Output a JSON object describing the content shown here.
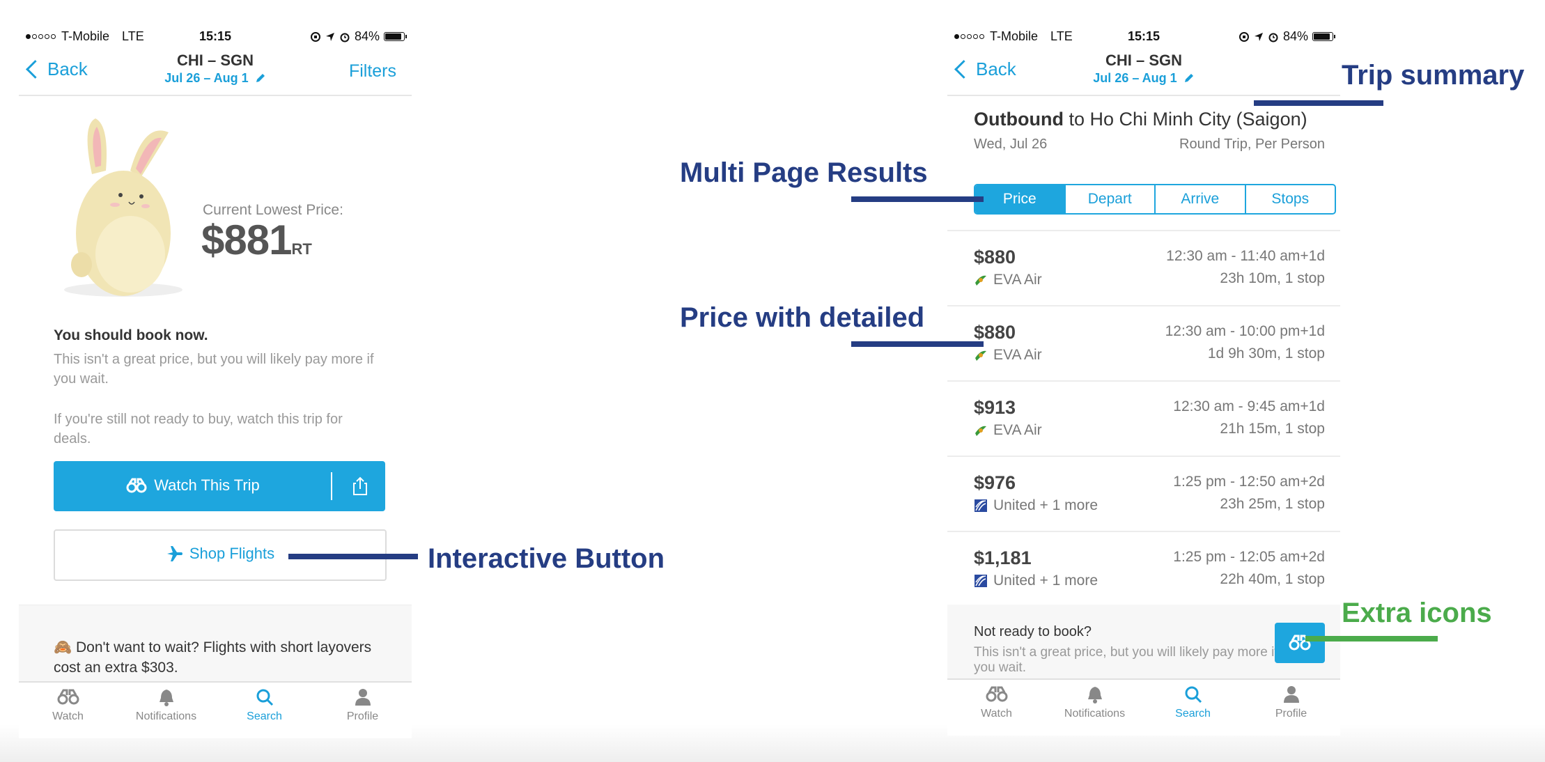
{
  "left_phone": {
    "status": {
      "carrier": "T-Mobile",
      "network": "LTE",
      "time": "15:15",
      "battery": "84%"
    },
    "nav": {
      "back": "Back",
      "title": "CHI – SGN",
      "dates": "Jul 26 – Aug 1",
      "filters": "Filters"
    },
    "price_panel": {
      "label": "Current Lowest Price:",
      "price": "$881",
      "suffix": "RT"
    },
    "advice": {
      "headline": "You should book now.",
      "body": "This isn't a great price, but you will likely pay more if you wait.",
      "watch_hint": "If you're still not ready to buy, watch this trip for deals."
    },
    "watch_button": "Watch This Trip",
    "shop_button": "Shop Flights",
    "layover_note": "🙈 Don't want to wait? Flights with short layovers cost an extra $303."
  },
  "right_phone": {
    "status": {
      "carrier": "T-Mobile",
      "network": "LTE",
      "time": "15:15",
      "battery": "84%"
    },
    "nav": {
      "back": "Back",
      "title": "CHI – SGN",
      "dates": "Jul 26 – Aug 1"
    },
    "trip": {
      "direction": "Outbound",
      "destination": "to Ho Chi Minh City (Saigon)",
      "date": "Wed, Jul 26",
      "fare_type": "Round Trip, Per Person"
    },
    "sort_tabs": [
      "Price",
      "Depart",
      "Arrive",
      "Stops"
    ],
    "results": [
      {
        "price": "$880",
        "airline": "EVA Air",
        "airline_icon": "eva-logo",
        "times": "12:30 am - 11:40 am+1d",
        "duration": "23h 10m, 1 stop"
      },
      {
        "price": "$880",
        "airline": "EVA Air",
        "airline_icon": "eva-logo",
        "times": "12:30 am - 10:00 pm+1d",
        "duration": "1d 9h 30m, 1 stop"
      },
      {
        "price": "$913",
        "airline": "EVA Air",
        "airline_icon": "eva-logo",
        "times": "12:30 am - 9:45 am+1d",
        "duration": "21h 15m, 1 stop"
      },
      {
        "price": "$976",
        "airline": "United + 1 more",
        "airline_icon": "united-logo",
        "times": "1:25 pm - 12:50 am+2d",
        "duration": "23h 25m, 1 stop"
      },
      {
        "price": "$1,181",
        "airline": "United + 1 more",
        "airline_icon": "united-logo",
        "times": "1:25 pm - 12:05 am+2d",
        "duration": "22h 40m, 1 stop"
      }
    ],
    "not_ready": {
      "title": "Not ready to book?",
      "body": "This isn't a great price, but you will likely pay more if you wait."
    }
  },
  "tabbar": [
    {
      "label": "Watch",
      "icon": "binoculars-icon"
    },
    {
      "label": "Notifications",
      "icon": "bell-icon"
    },
    {
      "label": "Search",
      "icon": "search-icon"
    },
    {
      "label": "Profile",
      "icon": "person-icon"
    }
  ],
  "active_tab": "Search",
  "annotations": {
    "trip_summary": "Trip summary",
    "multi_page": "Multi Page Results",
    "price_detail": "Price with detailed",
    "interactive_button": "Interactive Button",
    "extra_icons": "Extra icons"
  },
  "colors": {
    "accent": "#1ea6de",
    "annotation_blue": "#253d83",
    "annotation_green": "#4bab4b"
  }
}
